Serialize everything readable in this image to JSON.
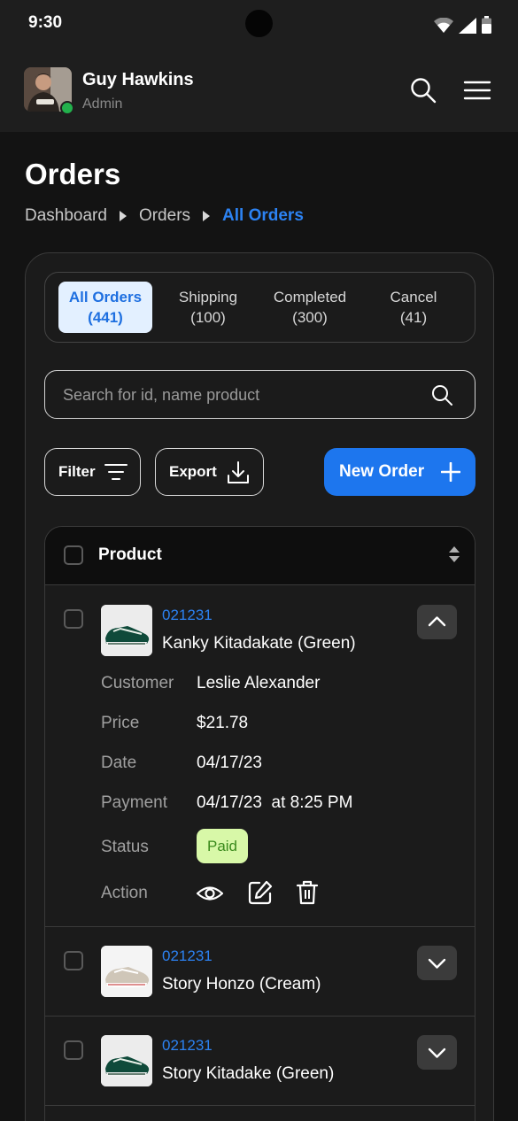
{
  "status_bar": {
    "time": "9:30"
  },
  "header": {
    "user_name": "Guy Hawkins",
    "user_role": "Admin"
  },
  "page": {
    "title": "Orders",
    "breadcrumb": [
      "Dashboard",
      "Orders",
      "All Orders"
    ]
  },
  "tabs": [
    {
      "label": "All Orders",
      "count": "(441)",
      "active": true
    },
    {
      "label": "Shipping",
      "count": "(100)",
      "active": false
    },
    {
      "label": "Completed",
      "count": "(300)",
      "active": false
    },
    {
      "label": "Cancel",
      "count": "(41)",
      "active": false
    }
  ],
  "search": {
    "placeholder": "Search for id, name product"
  },
  "toolbar": {
    "filter_label": "Filter",
    "export_label": "Export",
    "new_order_label": "New Order"
  },
  "table": {
    "header": "Product",
    "rows": [
      {
        "id": "021231",
        "name": "Kanky Kitadakate (Green)",
        "expanded": true,
        "details": {
          "customer_label": "Customer",
          "customer": "Leslie Alexander",
          "price_label": "Price",
          "price": "$21.78",
          "date_label": "Date",
          "date": "04/17/23",
          "payment_label": "Payment",
          "payment": "04/17/23  at 8:25 PM",
          "status_label": "Status",
          "status": "Paid",
          "action_label": "Action"
        }
      },
      {
        "id": "021231",
        "name": "Story Honzo (Cream)",
        "expanded": false
      },
      {
        "id": "021231",
        "name": "Story Kitadake (Green)",
        "expanded": false
      }
    ]
  },
  "colors": {
    "accent": "#1d76ee",
    "link": "#2c82f2",
    "online": "#22b14c",
    "paid_bg": "#d8f8a8",
    "paid_text": "#3a8a1c"
  }
}
